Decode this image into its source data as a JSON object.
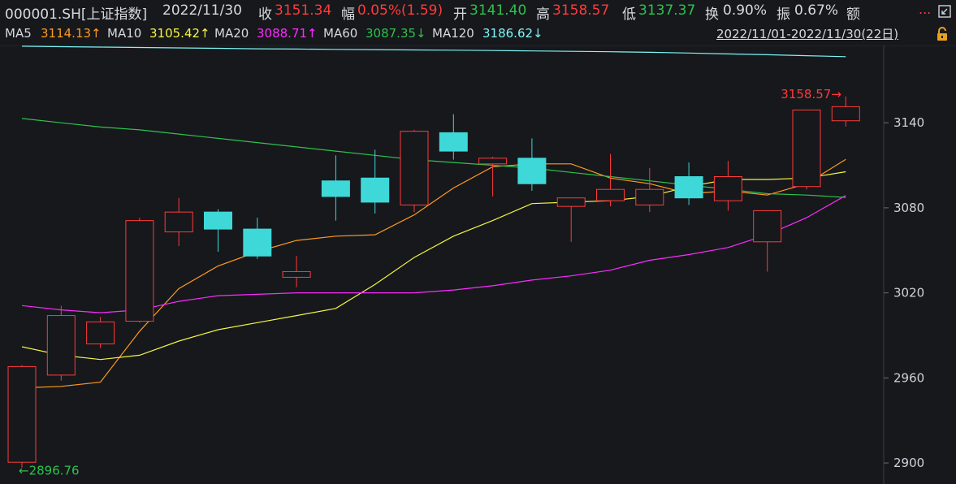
{
  "quote": {
    "code": "000001.SH[上证指数]",
    "date": "2022/11/30",
    "close_label": "收",
    "close": "3151.34",
    "change_label": "幅",
    "change": "0.05%(1.59)",
    "open_label": "开",
    "open": "3141.40",
    "high_label": "高",
    "high": "3158.57",
    "low_label": "低",
    "low": "3137.37",
    "turnover_label": "换",
    "turnover": "0.90%",
    "amplitude_label": "振",
    "amplitude": "0.67%",
    "amount_label": "额",
    "more": "..."
  },
  "ma": {
    "ma5_label": "MA5",
    "ma5": "3114.13↑",
    "ma10_label": "MA10",
    "ma10": "3105.42↑",
    "ma20_label": "MA20",
    "ma20": "3088.71↑",
    "ma60_label": "MA60",
    "ma60": "3087.35↓",
    "ma120_label": "MA120",
    "ma120": "3186.62↓",
    "range": "2022/11/01-2022/11/30(22日)"
  },
  "colors": {
    "up": "#ff3b3b",
    "down": "#3fd8d8",
    "ma5": "#ff9a1f",
    "ma10": "#f5f542",
    "ma20": "#ff2bff",
    "ma60": "#2ec24d",
    "ma120": "#7ff5f5",
    "grid": "#2a2d33"
  },
  "icons": {
    "lock": "lock-icon",
    "expand": "expand-icon"
  },
  "chart_data": {
    "type": "candlestick",
    "ylim": [
      2880,
      3210
    ],
    "yticks": [
      2900,
      2960,
      3020,
      3080,
      3140,
      3200
    ],
    "max_label": "3158.57→",
    "min_label": "←2896.76",
    "candles": [
      {
        "o": 2900.5,
        "h": 2969.0,
        "l": 2896.76,
        "c": 2968.0
      },
      {
        "o": 2962.0,
        "h": 3011.0,
        "l": 2958.0,
        "c": 3004.0
      },
      {
        "o": 2984.0,
        "h": 3003.0,
        "l": 2981.0,
        "c": 2999.5
      },
      {
        "o": 3000.0,
        "h": 3073.0,
        "l": 2999.0,
        "c": 3071.0
      },
      {
        "o": 3063.0,
        "h": 3087.0,
        "l": 3053.0,
        "c": 3077.0
      },
      {
        "o": 3077.0,
        "h": 3079.0,
        "l": 3049.0,
        "c": 3065.0
      },
      {
        "o": 3065.0,
        "h": 3073.0,
        "l": 3044.0,
        "c": 3046.0
      },
      {
        "o": 3031.0,
        "h": 3046.0,
        "l": 3024.0,
        "c": 3035.0
      },
      {
        "o": 3099.0,
        "h": 3117.0,
        "l": 3071.0,
        "c": 3088.0
      },
      {
        "o": 3101.0,
        "h": 3121.0,
        "l": 3076.0,
        "c": 3084.0
      },
      {
        "o": 3082.0,
        "h": 3135.0,
        "l": 3077.0,
        "c": 3134.0
      },
      {
        "o": 3133.0,
        "h": 3146.0,
        "l": 3114.0,
        "c": 3120.0
      },
      {
        "o": 3111.0,
        "h": 3116.0,
        "l": 3088.0,
        "c": 3115.0
      },
      {
        "o": 3115.0,
        "h": 3129.0,
        "l": 3092.0,
        "c": 3097.0
      },
      {
        "o": 3081.0,
        "h": 3087.0,
        "l": 3056.0,
        "c": 3087.0
      },
      {
        "o": 3085.0,
        "h": 3118.0,
        "l": 3081.0,
        "c": 3093.0
      },
      {
        "o": 3082.0,
        "h": 3108.0,
        "l": 3077.0,
        "c": 3093.0
      },
      {
        "o": 3102.0,
        "h": 3112.0,
        "l": 3082.0,
        "c": 3087.0
      },
      {
        "o": 3085.0,
        "h": 3113.0,
        "l": 3078.0,
        "c": 3102.0
      },
      {
        "o": 3056.0,
        "h": 3077.0,
        "l": 3035.0,
        "c": 3078.0
      },
      {
        "o": 3095.0,
        "h": 3149.0,
        "l": 3093.0,
        "c": 3149.0
      },
      {
        "o": 3141.4,
        "h": 3158.57,
        "l": 3137.37,
        "c": 3151.34
      }
    ],
    "series": [
      {
        "name": "MA5",
        "values": [
          2953,
          2954,
          2957,
          2993,
          3023,
          3039,
          3049,
          3057,
          3060,
          3061,
          3075,
          3094,
          3109,
          3111,
          3111,
          3101,
          3097,
          3090,
          3092,
          3089,
          3097,
          3114.13
        ]
      },
      {
        "name": "MA10",
        "values": [
          2982,
          2976,
          2973,
          2976,
          2986,
          2994,
          2999,
          3004,
          3009,
          3026,
          3045,
          3060,
          3071,
          3083,
          3084,
          3085,
          3088,
          3095,
          3100,
          3100,
          3101,
          3105.42
        ]
      },
      {
        "name": "MA20",
        "values": [
          3011,
          3008,
          3006,
          3008,
          3014,
          3018,
          3019,
          3020,
          3020,
          3020,
          3020,
          3022,
          3025,
          3029,
          3032,
          3036,
          3043,
          3047,
          3052,
          3061,
          3073,
          3088.71
        ]
      },
      {
        "name": "MA60",
        "values": [
          3143,
          3140,
          3137,
          3135,
          3132,
          3129,
          3126,
          3123,
          3120,
          3117,
          3114,
          3112,
          3110,
          3108,
          3105,
          3102,
          3099,
          3096,
          3093,
          3090,
          3089,
          3087.35
        ]
      },
      {
        "name": "MA120",
        "values": [
          3194,
          3193.7,
          3193.4,
          3193.1,
          3192.8,
          3192.5,
          3192.2,
          3192,
          3191.8,
          3191.6,
          3191.4,
          3191.2,
          3191,
          3190.7,
          3190.4,
          3190.1,
          3189.7,
          3189.2,
          3188.6,
          3188,
          3187.3,
          3186.62
        ]
      }
    ]
  }
}
